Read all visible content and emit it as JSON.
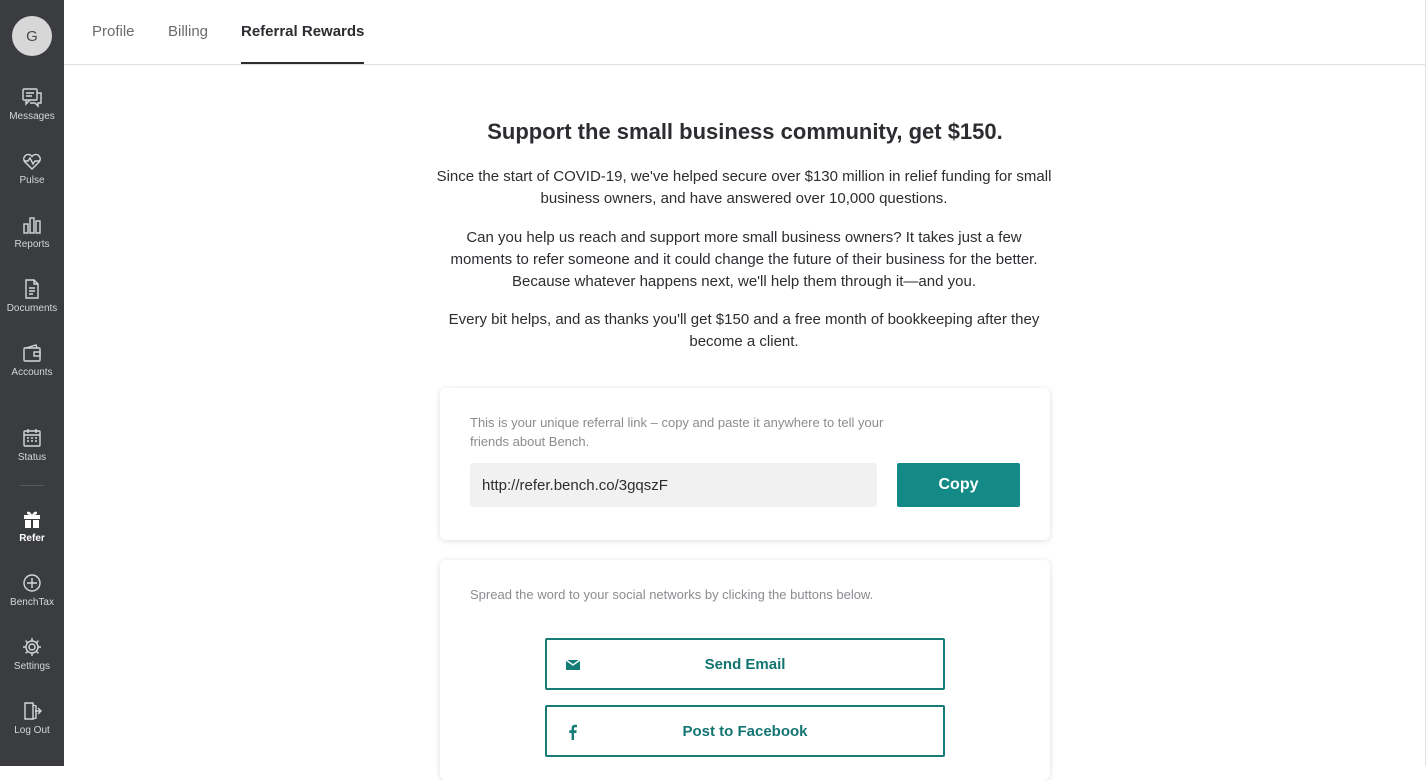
{
  "user": {
    "avatar_initial": "G"
  },
  "sidebar": {
    "items": [
      {
        "label": "Messages",
        "icon": "messages-icon"
      },
      {
        "label": "Pulse",
        "icon": "pulse-icon"
      },
      {
        "label": "Reports",
        "icon": "reports-icon"
      },
      {
        "label": "Documents",
        "icon": "documents-icon"
      },
      {
        "label": "Accounts",
        "icon": "accounts-icon"
      },
      {
        "label": "Status",
        "icon": "calendar-icon"
      },
      {
        "label": "Refer",
        "icon": "gift-icon",
        "active": true
      },
      {
        "label": "BenchTax",
        "icon": "benchtax-icon"
      },
      {
        "label": "Settings",
        "icon": "gear-icon"
      },
      {
        "label": "Log Out",
        "icon": "logout-icon"
      }
    ]
  },
  "tabs": [
    {
      "label": "Profile"
    },
    {
      "label": "Billing"
    },
    {
      "label": "Referral Rewards",
      "active": true
    }
  ],
  "content": {
    "headline": "Support the small business community, get $150.",
    "paragraphs": [
      "Since the start of COVID-19, we've helped secure over $130 million in relief funding for small business owners, and have answered over 10,000 questions.",
      "Can you help us reach and support more small business owners? It takes just a few moments to refer someone and it could change the future of their business for the better. Because whatever happens next, we'll help them through it—and you.",
      "Every bit helps, and as thanks you'll get $150 and a free month of bookkeeping after they become a client."
    ]
  },
  "referral_card": {
    "note": "This is your unique referral link – copy and paste it anywhere to tell your friends about Bench.",
    "link_value": "http://refer.bench.co/3gqszF",
    "copy_label": "Copy"
  },
  "social_card": {
    "note": "Spread the word to your social networks by clicking the buttons below.",
    "email_label": "Send Email",
    "facebook_label": "Post to Facebook"
  },
  "colors": {
    "sidebar_bg": "#3a3c3f",
    "accent_teal": "#138a86",
    "text_dark": "#2b2d31"
  }
}
